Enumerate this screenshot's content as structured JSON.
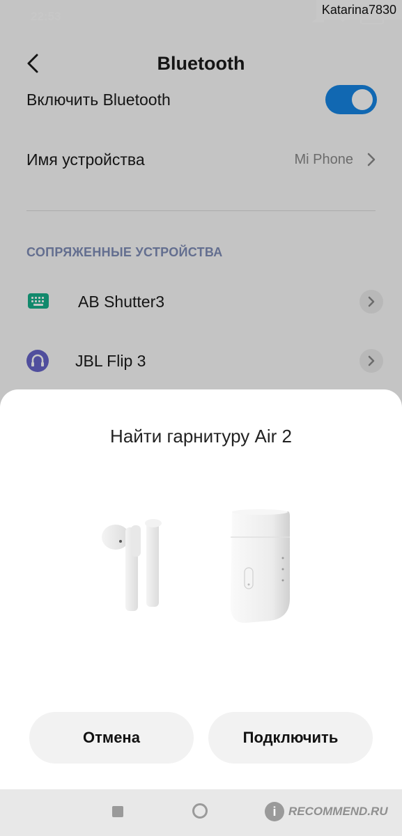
{
  "status_bar": {
    "time": "22:53",
    "watermark": "Katarina7830"
  },
  "header": {
    "title": "Bluetooth",
    "back_icon": "back-arrow-icon"
  },
  "settings": {
    "enable_label": "Включить Bluetooth",
    "enable_state": true,
    "device_name_label": "Имя устройства",
    "device_name_value": "Mi Phone"
  },
  "paired": {
    "section_title": "СОПРЯЖЕННЫЕ УСТРОЙСТВА",
    "devices": [
      {
        "name": "AB Shutter3",
        "icon": "keyboard-icon",
        "icon_color": "#18b08b"
      },
      {
        "name": "JBL Flip 3",
        "icon": "headset-icon",
        "icon_color": "#6765c9"
      }
    ]
  },
  "dialog": {
    "title": "Найти гарнитуру Air 2",
    "cancel_label": "Отмена",
    "connect_label": "Подключить"
  },
  "nav_bar": {
    "watermark_logo": "i",
    "watermark_text": "RECOMMEND.RU"
  },
  "colors": {
    "accent": "#1786e5",
    "section": "#7f8db8"
  }
}
